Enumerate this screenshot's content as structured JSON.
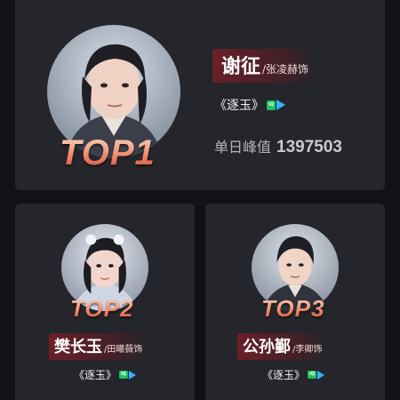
{
  "entries": [
    {
      "rank_label": "TOP1",
      "character": "谢征",
      "actor": "/张凌赫饰",
      "drama": "《逐玉》",
      "badge_text": "爱奇艺",
      "stat_label": "单日峰值",
      "stat_value": "1397503"
    },
    {
      "rank_label": "TOP2",
      "character": "樊长玉",
      "actor": "/田曦薇饰",
      "drama": "《逐玉》",
      "badge_text": "爱奇艺"
    },
    {
      "rank_label": "TOP3",
      "character": "公孙鄞",
      "actor": "/李卿饰",
      "drama": "《逐玉》",
      "badge_text": "爱奇艺"
    }
  ],
  "colors": {
    "background": "#111215",
    "card": "#25262b",
    "rank_gradient_top": "#ffd9c8",
    "rank_gradient_bottom": "#c9423a",
    "name_pill": "#781e28",
    "badge_green": "#20c05c",
    "badge_blue": "#2fb3ff"
  },
  "icons": {
    "platform": "iqiyi-platform-icon"
  }
}
